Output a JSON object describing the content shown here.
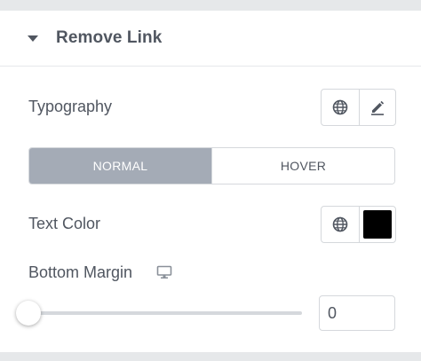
{
  "section": {
    "title": "Remove Link",
    "caret_icon": "caret-down-icon"
  },
  "typography": {
    "label": "Typography",
    "global_icon": "globe-icon",
    "edit_icon": "pencil-icon"
  },
  "state_tabs": {
    "normal": "NORMAL",
    "hover": "HOVER",
    "active": "normal",
    "active_color": "#a4abb6"
  },
  "text_color": {
    "label": "Text Color",
    "global_icon": "globe-icon",
    "value": "#000000"
  },
  "bottom_margin": {
    "label": "Bottom Margin",
    "device_icon": "desktop-monitor-icon",
    "slider_value": 0,
    "input_value": "0"
  }
}
